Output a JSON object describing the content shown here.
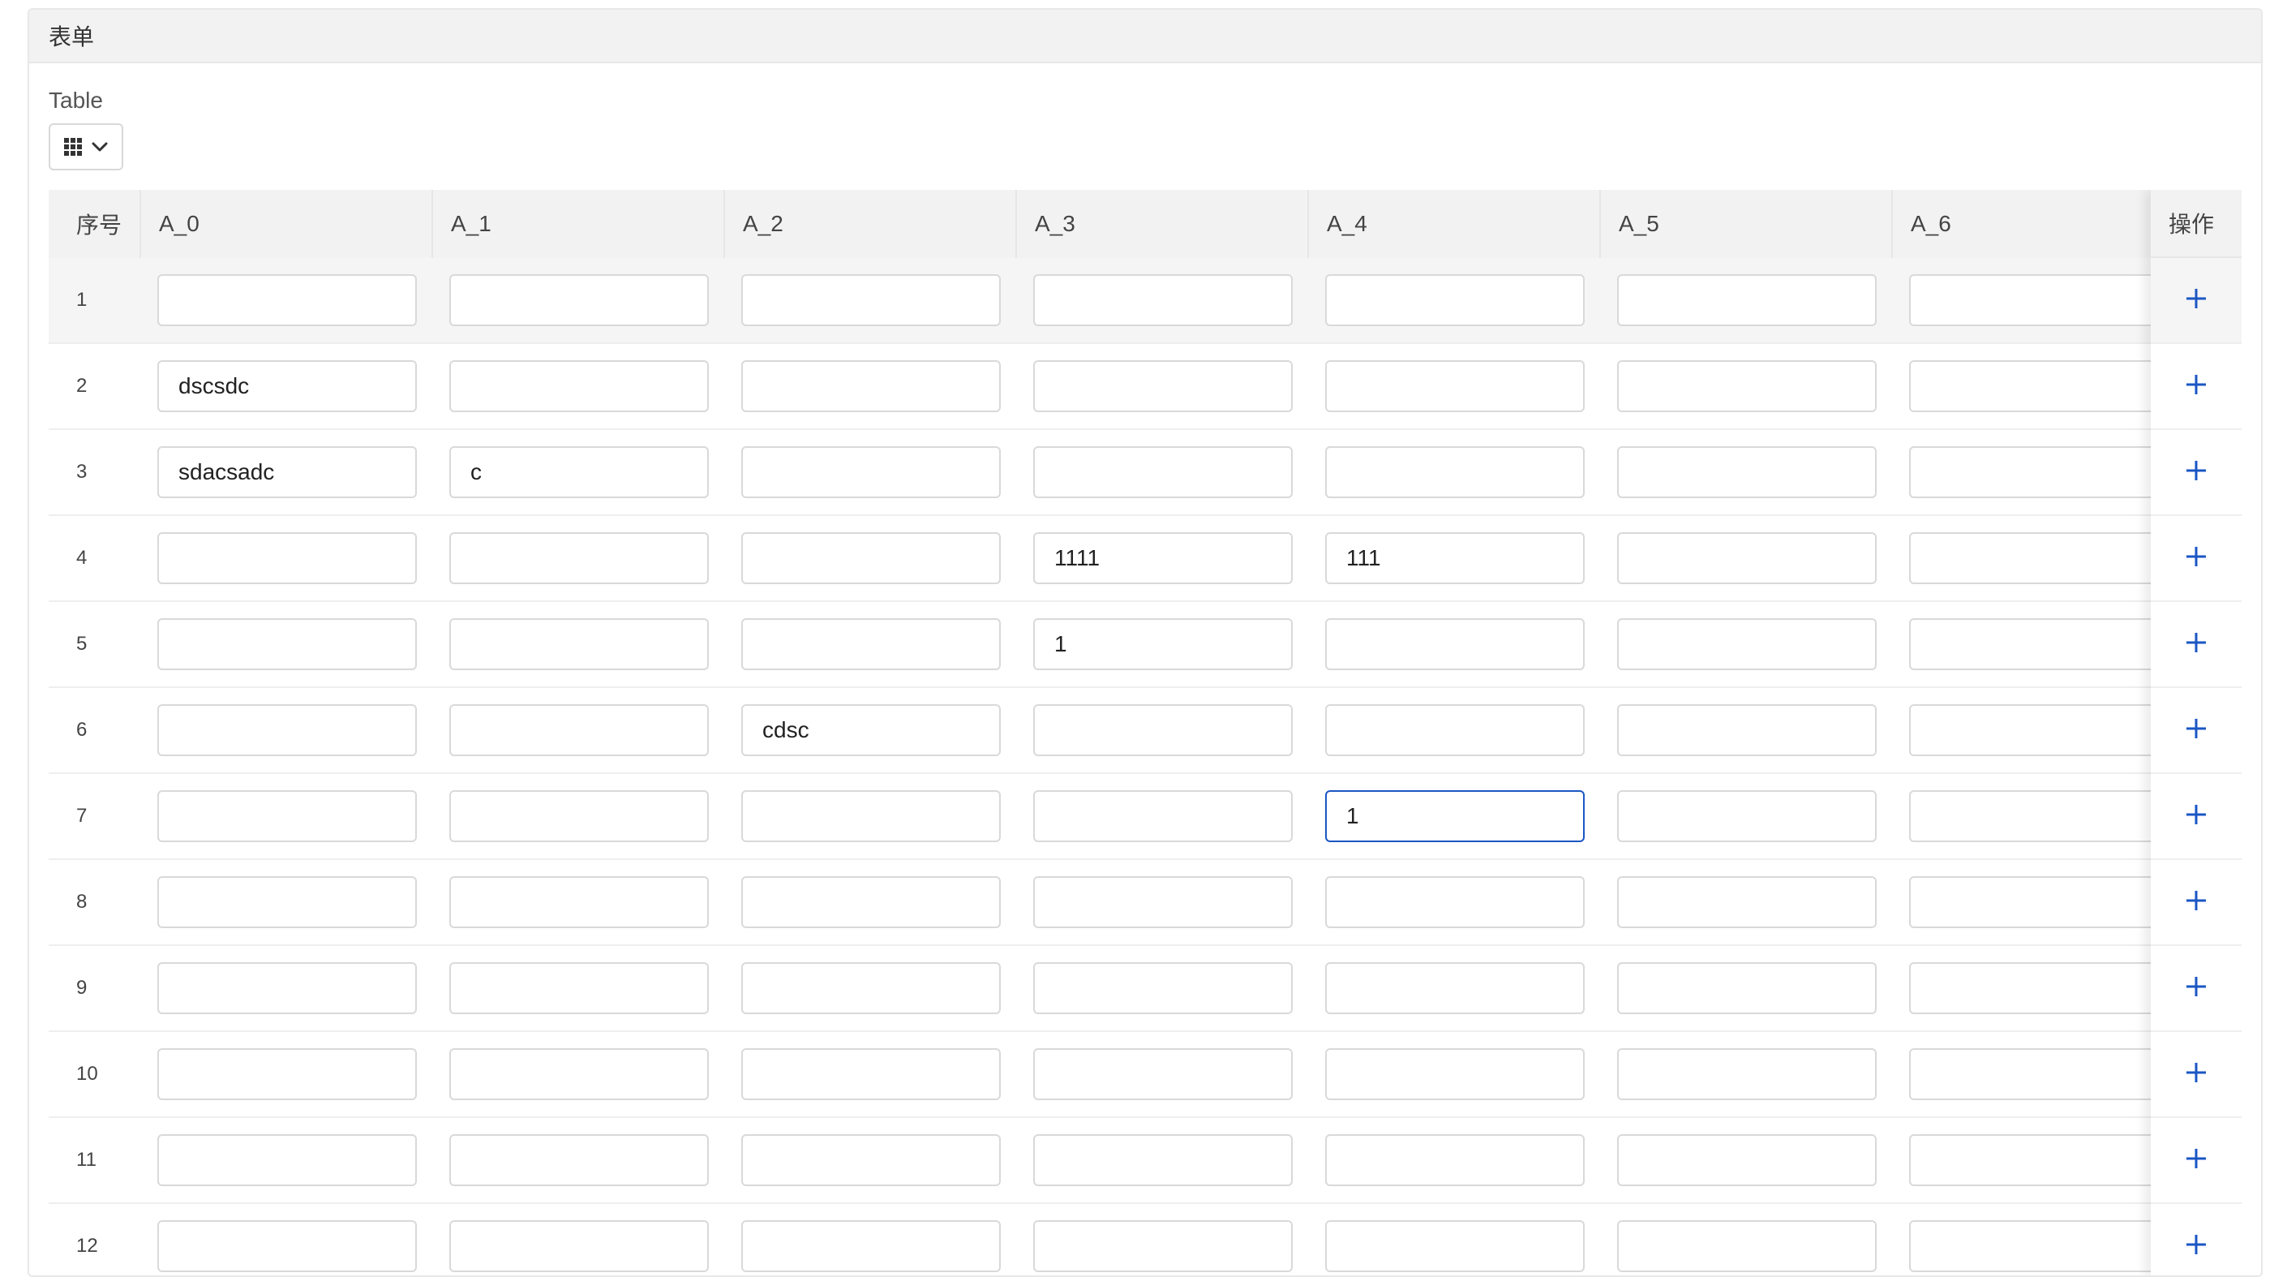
{
  "panel": {
    "title": "表单"
  },
  "field": {
    "label": "Table"
  },
  "view_toggle": {
    "icon": "grid-icon",
    "caret_icon": "chevron-down-icon"
  },
  "table": {
    "index_header": "序号",
    "columns": [
      "A_0",
      "A_1",
      "A_2",
      "A_3",
      "A_4",
      "A_5",
      "A_6"
    ],
    "ops_header": "操作",
    "add_icon": "plus-icon",
    "accent_color": "#1a56c4",
    "focused_row": 7,
    "focused_col": 4,
    "highlighted_row": 1,
    "rows": [
      {
        "index": "1",
        "cells": [
          "",
          "",
          "",
          "",
          "",
          "",
          ""
        ]
      },
      {
        "index": "2",
        "cells": [
          "dscsdc",
          "",
          "",
          "",
          "",
          "",
          ""
        ]
      },
      {
        "index": "3",
        "cells": [
          "sdacsadc",
          "c",
          "",
          "",
          "",
          "",
          ""
        ]
      },
      {
        "index": "4",
        "cells": [
          "",
          "",
          "",
          "1111",
          "111",
          "",
          ""
        ]
      },
      {
        "index": "5",
        "cells": [
          "",
          "",
          "",
          "1",
          "",
          "",
          ""
        ]
      },
      {
        "index": "6",
        "cells": [
          "",
          "",
          "cdsc",
          "",
          "",
          "",
          ""
        ]
      },
      {
        "index": "7",
        "cells": [
          "",
          "",
          "",
          "",
          "1",
          "",
          ""
        ]
      },
      {
        "index": "8",
        "cells": [
          "",
          "",
          "",
          "",
          "",
          "",
          ""
        ]
      },
      {
        "index": "9",
        "cells": [
          "",
          "",
          "",
          "",
          "",
          "",
          ""
        ]
      },
      {
        "index": "10",
        "cells": [
          "",
          "",
          "",
          "",
          "",
          "",
          ""
        ]
      },
      {
        "index": "11",
        "cells": [
          "",
          "",
          "",
          "",
          "",
          "",
          ""
        ]
      },
      {
        "index": "12",
        "cells": [
          "",
          "",
          "",
          "",
          "",
          "",
          ""
        ]
      }
    ]
  }
}
